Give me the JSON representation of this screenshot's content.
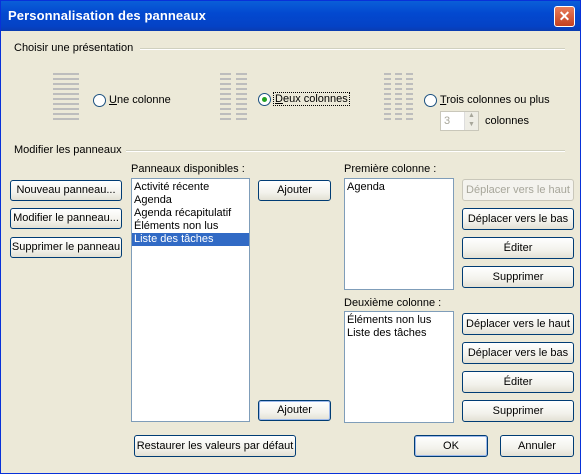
{
  "title": "Personnalisation des panneaux",
  "presentation": {
    "group_label": "Choisir une présentation",
    "option1": "Une colonne",
    "option2": "Deux colonnes",
    "option3": "Trois colonnes ou plus",
    "selected": "option2",
    "columns_value": "3",
    "columns_label": "colonnes"
  },
  "panels": {
    "group_label": "Modifier les panneaux",
    "new_button": "Nouveau panneau...",
    "modify_button": "Modifier le panneau...",
    "delete_button": "Supprimer le panneau",
    "available_label": "Panneaux disponibles :",
    "available_items": [
      "Activité récente",
      "Agenda",
      "Agenda récapitulatif",
      "Éléments non lus",
      "Liste des tâches"
    ],
    "available_selected_index": 4,
    "add_button_1": "Ajouter",
    "add_button_2": "Ajouter",
    "col1_label": "Première colonne :",
    "col1_items": [
      "Agenda"
    ],
    "col2_label": "Deuxième colonne :",
    "col2_items": [
      "Éléments non lus",
      "Liste des tâches"
    ],
    "move_up": "Déplacer vers le haut",
    "move_down": "Déplacer vers le bas",
    "edit": "Éditer",
    "remove": "Supprimer"
  },
  "footer": {
    "restore": "Restaurer les valeurs par défaut",
    "ok": "OK",
    "cancel": "Annuler"
  }
}
